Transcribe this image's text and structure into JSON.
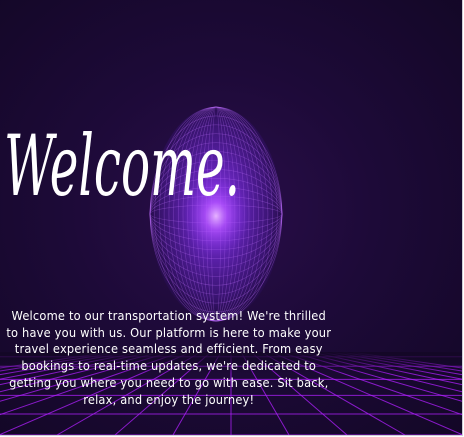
{
  "hero": {
    "title": "Welcome.",
    "description": "Welcome to our transportation system! We're thrilled to have you with us. Our platform is here to make your travel experience seamless and efficient. From easy bookings to real-time updates, we're dedicated to getting you where you need to go with ease. Sit back, relax, and enjoy the journey!"
  },
  "colors": {
    "background": "#1d0a38",
    "orb_glow": "#a040ff",
    "grid_line": "#b020ff",
    "text": "#ffffff"
  },
  "decor": {
    "orb": "wireframe-sphere-icon",
    "floor": "neon-grid"
  }
}
